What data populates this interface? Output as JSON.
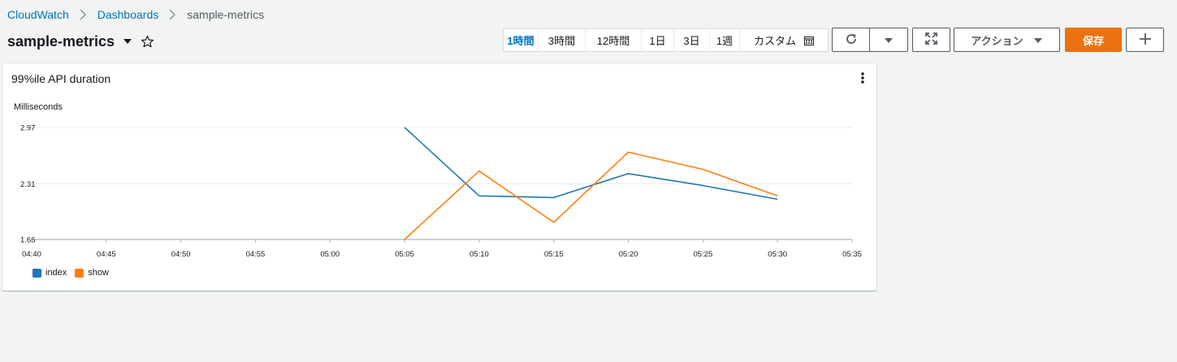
{
  "breadcrumb": {
    "items": [
      "CloudWatch",
      "Dashboards"
    ],
    "current": "sample-metrics"
  },
  "page": {
    "title": "sample-metrics"
  },
  "time_range": {
    "options": [
      "1時間",
      "3時間",
      "12時間",
      "1日",
      "3日",
      "1週",
      "カスタム"
    ],
    "selected": "1時間"
  },
  "toolbar": {
    "actions_label": "アクション",
    "save_label": "保存"
  },
  "colors": {
    "index": "#1f77b4",
    "show": "#ff7f0e",
    "save": "#ec7211",
    "link": "#0073bb"
  },
  "widget": {
    "title": "99%ile API duration"
  },
  "chart_data": {
    "type": "line",
    "ylabel": "Milliseconds",
    "yticks": [
      "1.66",
      "2.31",
      "2.97"
    ],
    "ylim": [
      1.66,
      2.97
    ],
    "xticks": [
      "04:40",
      "04:45",
      "04:50",
      "04:55",
      "05:00",
      "05:05",
      "05:10",
      "05:15",
      "05:20",
      "05:25",
      "05:30",
      "05:35"
    ],
    "series": [
      {
        "name": "index",
        "points": [
          [
            "05:05",
            2.97
          ],
          [
            "05:10",
            2.17
          ],
          [
            "05:15",
            2.15
          ],
          [
            "05:20",
            2.43
          ],
          [
            "05:25",
            2.29
          ],
          [
            "05:30",
            2.13
          ]
        ]
      },
      {
        "name": "show",
        "points": [
          [
            "05:05",
            1.66
          ],
          [
            "05:10",
            2.46
          ],
          [
            "05:15",
            1.86
          ],
          [
            "05:20",
            2.68
          ],
          [
            "05:25",
            2.48
          ],
          [
            "05:30",
            2.17
          ]
        ]
      }
    ],
    "legend_position": "bottom-left",
    "grid": true
  }
}
